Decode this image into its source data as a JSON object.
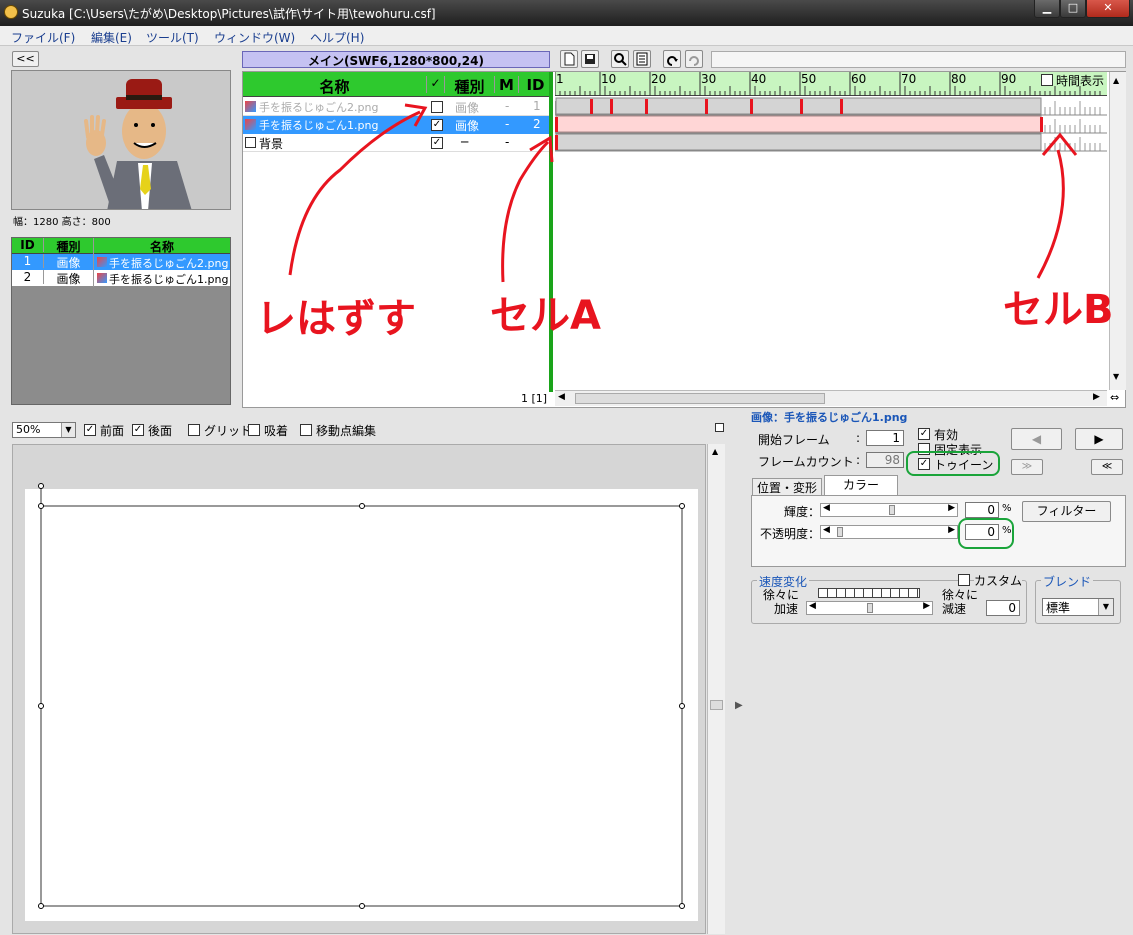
{
  "window": {
    "title": "Suzuka [C:\\Users\\たがめ\\Desktop\\Pictures\\試作\\サイト用\\tewohuru.csf]",
    "min": "▁",
    "max": "□",
    "close": "✕"
  },
  "menu": [
    "ファイル(F)",
    "編集(E)",
    "ツール(T)",
    "ウィンドウ(W)",
    "ヘルプ(H)"
  ],
  "leftpanel": {
    "collapse": "<<",
    "dims": "幅：1280 高さ：800",
    "assets_headers": [
      "ID",
      "種別",
      "名称"
    ],
    "assets": [
      {
        "id": "1",
        "type": "画像",
        "name": "手を振るじゅごん2.png",
        "selected": true
      },
      {
        "id": "2",
        "type": "画像",
        "name": "手を振るじゅごん1.png",
        "selected": false
      }
    ]
  },
  "scene": {
    "title": "メイン(SWF6,1280*800,24)"
  },
  "layers": {
    "headers": {
      "name": "名称",
      "check": "✓",
      "type": "種別",
      "m": "M",
      "id": "ID"
    },
    "rows": [
      {
        "name": "手を振るじゅごん2.png",
        "check": "",
        "type": "画像",
        "m": "-",
        "id": "1",
        "state": "disabled"
      },
      {
        "name": "手を振るじゅごん1.png",
        "check": "✓",
        "type": "画像",
        "m": "-",
        "id": "2",
        "state": "selected"
      },
      {
        "name": "背景",
        "check": "✓",
        "type": "─",
        "m": "-",
        "id": "",
        "state": "normal"
      }
    ],
    "footer": "1 [1]"
  },
  "timeline": {
    "ruler": [
      "1",
      "10",
      "20",
      "30",
      "40",
      "50",
      "60",
      "70",
      "80",
      "90"
    ],
    "time_display": "時間表示",
    "row1_keys": [
      8,
      12,
      19,
      31,
      40,
      50,
      58
    ],
    "row2_end": 98
  },
  "annotations": {
    "remove": "レはずす",
    "cellA": "セルA",
    "cellB": "セルB"
  },
  "stage": {
    "zoom": "50%",
    "front": "前面",
    "back": "後面",
    "grid": "グリッド",
    "snap": "吸着",
    "movepoint": "移動点編集"
  },
  "props": {
    "title": "画像：手を振るじゅごん1.png",
    "start_label": "開始フレーム",
    "start_value": "1",
    "count_label": "フレームカウント",
    "count_value": "98",
    "valid": "有効",
    "fixed": "固定表示",
    "tween": "トゥイーン",
    "tabs": [
      "位置・変形",
      "カラー"
    ],
    "brightness_label": "輝度：",
    "brightness_value": "0",
    "opacity_label": "不透明度：",
    "opacity_value": "0",
    "percent": "%",
    "filter": "フィルター",
    "speed_group": "速度変化",
    "custom": "カスタム",
    "accel_line1": "徐々に",
    "accel_line2": "加速",
    "decel_line1": "徐々に",
    "decel_line2": "減速",
    "decel_value": "0",
    "blend_group": "ブレンド",
    "blend_value": "標準"
  },
  "colors": {
    "green": "#2ec92e",
    "select": "#3399ff",
    "red": "#e8141f",
    "pink": "#ffd6d6",
    "timeline_green": "#c8f5c0",
    "annot_green": "#1aa43a"
  }
}
